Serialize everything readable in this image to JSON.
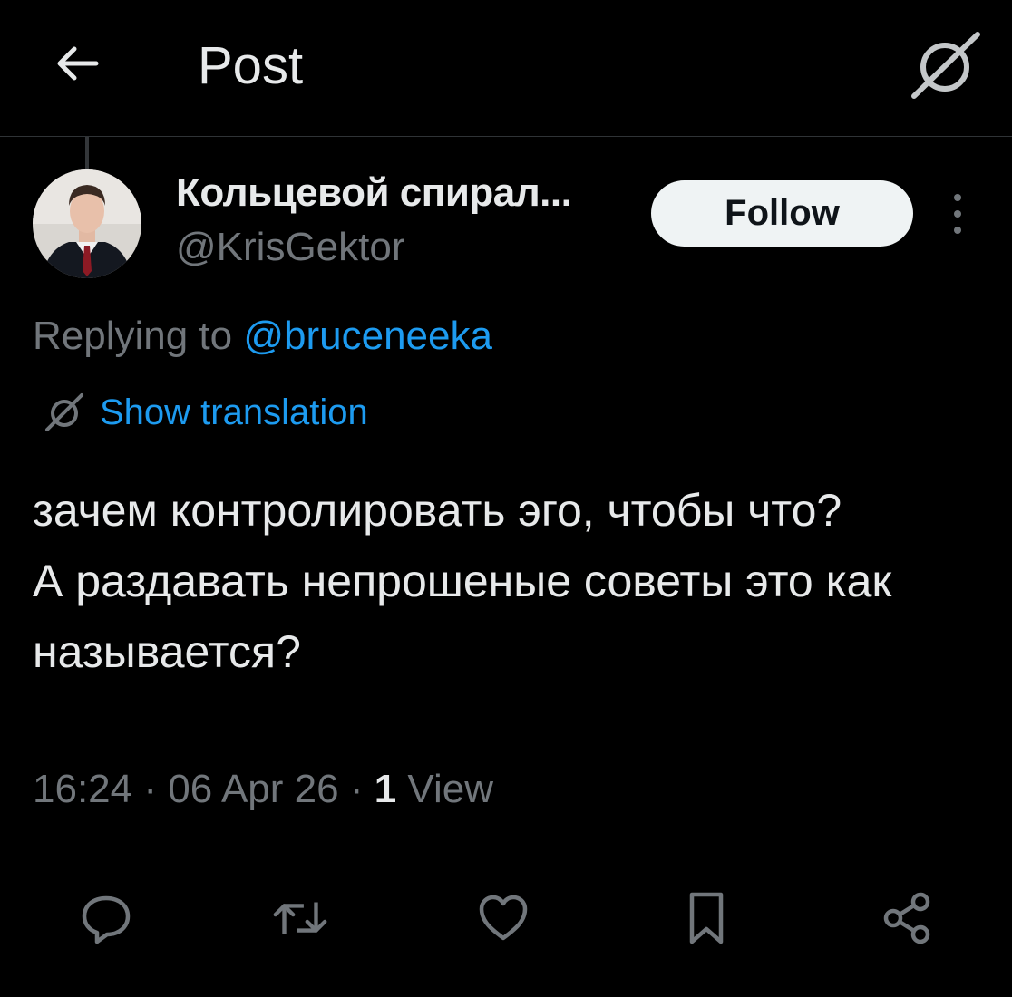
{
  "header": {
    "title": "Post",
    "back_icon": "arrow-left-icon",
    "translate_icon": "translate-icon"
  },
  "author": {
    "display_name": "Кольцевой спирал...",
    "handle": "@KrisGektor",
    "follow_label": "Follow",
    "more_icon": "more-vertical-icon"
  },
  "reply": {
    "prefix": "Replying to ",
    "mention": "@bruceneeka"
  },
  "translation": {
    "label": "Show translation",
    "icon": "translate-icon"
  },
  "post": {
    "line1": "зачем контролировать эго, чтобы что?",
    "line2": "А раздавать непрошеные советы это как называется?"
  },
  "meta": {
    "time": "16:24",
    "separator1": " · ",
    "date": "06 Apr 26",
    "separator2": " · ",
    "views_count": "1",
    "views_label": " View"
  },
  "actions": [
    {
      "name": "reply",
      "icon": "reply-icon"
    },
    {
      "name": "repost",
      "icon": "repost-icon"
    },
    {
      "name": "like",
      "icon": "heart-icon"
    },
    {
      "name": "bookmark",
      "icon": "bookmark-icon"
    },
    {
      "name": "share",
      "icon": "share-icon"
    }
  ],
  "colors": {
    "background": "#000000",
    "text": "#e7e9ea",
    "secondary": "#71767b",
    "accent": "#1d9bf0",
    "follow_bg": "#eff3f4"
  }
}
